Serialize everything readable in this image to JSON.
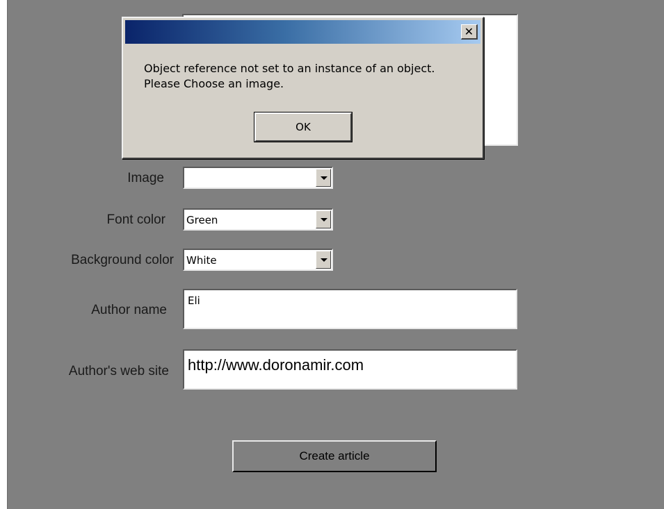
{
  "form": {
    "image_label": "Image",
    "image_value": "",
    "font_color_label": "Font color",
    "font_color_value": "Green",
    "background_color_label": "Background color",
    "background_color_value": "White",
    "author_name_label": "Author name",
    "author_name_value": "Eli",
    "author_site_label": "Author's web site",
    "author_site_value": "http://www.doronamir.com",
    "create_button": "Create article"
  },
  "dialog": {
    "close_glyph": "✕",
    "message_line1": "Object reference not set to an instance of an object.",
    "message_line2": "Please Choose an image.",
    "ok_button": "OK"
  },
  "colors": {
    "form_background": "#808080",
    "dialog_face": "#d4d0c8",
    "titlebar_start": "#0a246a",
    "titlebar_end": "#a6caf0"
  },
  "icons": {
    "dropdown_arrow": "chevron-down-icon",
    "close": "close-icon"
  }
}
